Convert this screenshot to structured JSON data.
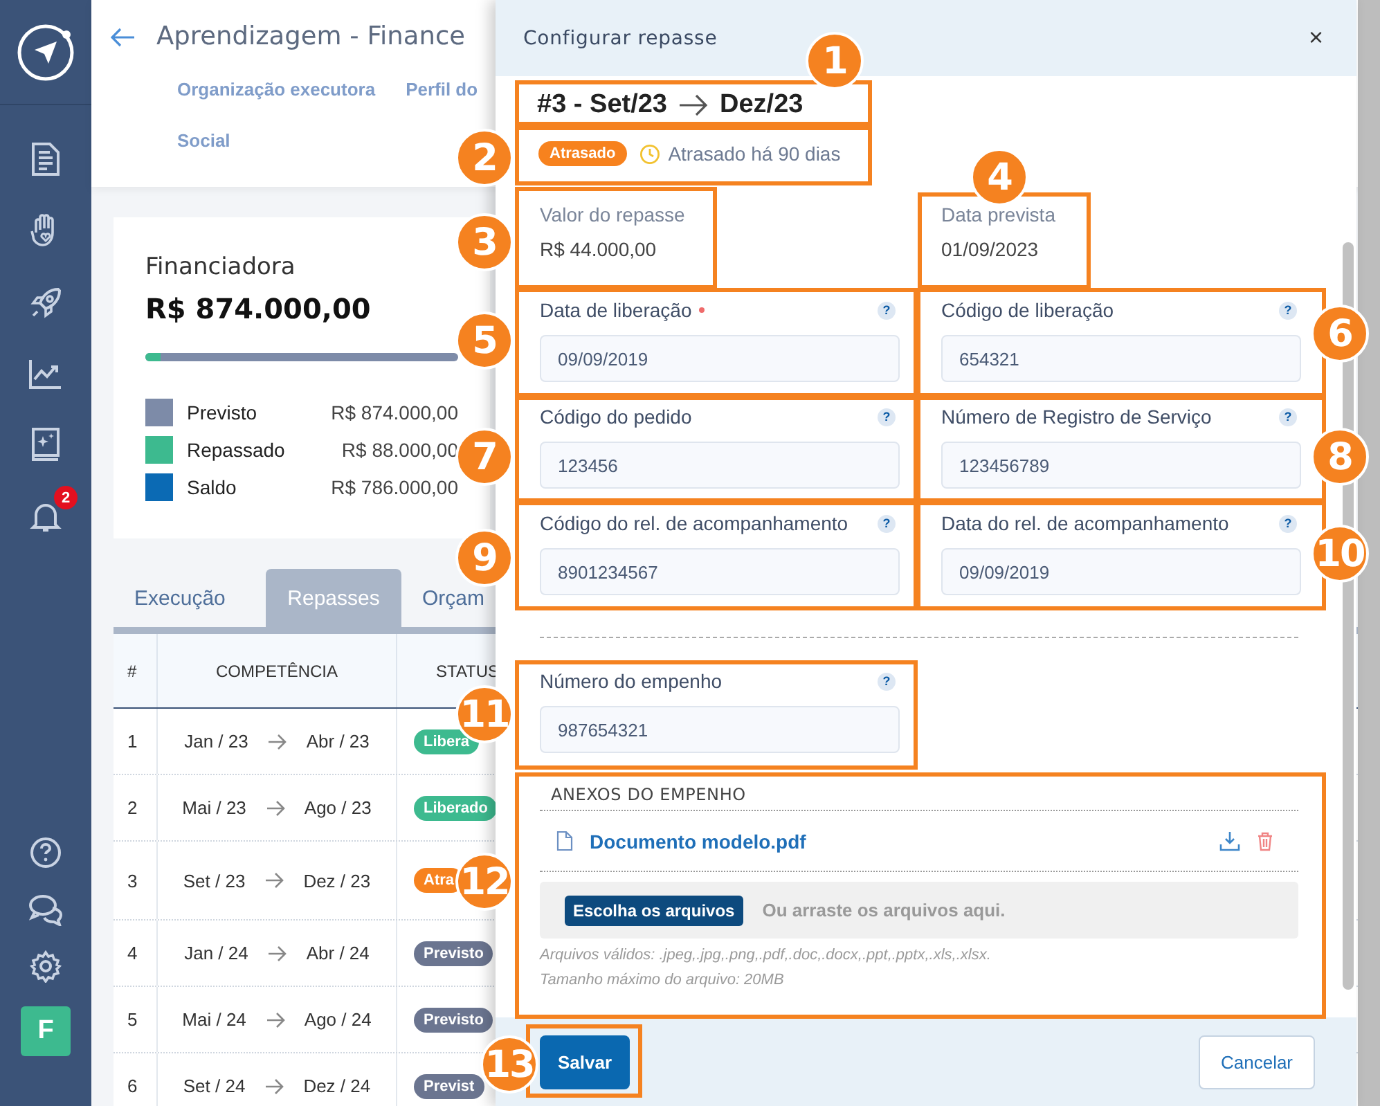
{
  "sidebar": {
    "notification_count": "2",
    "avatar": "F"
  },
  "page": {
    "title": "Aprendizagem - Finance",
    "nav_links": [
      "Organização executora",
      "Perfil do",
      "Social"
    ],
    "summary": {
      "title": "Financiadora",
      "total": "R$ 874.000,00",
      "progress": {
        "level": 0.05
      },
      "legend": [
        {
          "label": "Previsto",
          "value": "R$ 874.000,00",
          "color": "#7d8ba8"
        },
        {
          "label": "Repassado",
          "value": "R$ 88.000,00",
          "color": "#3dba8f"
        },
        {
          "label": "Saldo",
          "value": "R$ 786.000,00",
          "color": "#0b6ab4"
        }
      ]
    },
    "tabs": [
      {
        "label": "Execução",
        "selected": false
      },
      {
        "label": "Repasses",
        "selected": true
      },
      {
        "label": "Orçam",
        "selected": false
      }
    ],
    "table": {
      "columns": [
        "#",
        "COMPETÊNCIA",
        "STATUS"
      ],
      "rows": [
        {
          "number": "1",
          "from": "Jan / 23",
          "to": "Abr / 23",
          "status": "Libera",
          "kind": "released"
        },
        {
          "number": "2",
          "from": "Mai / 23",
          "to": "Ago / 23",
          "status": "Liberado",
          "kind": "released"
        },
        {
          "number": "3",
          "from": "Set / 23",
          "to": "Dez / 23",
          "status": "Atra",
          "kind": "late"
        },
        {
          "number": "4",
          "from": "Jan / 24",
          "to": "Abr / 24",
          "status": "Previsto",
          "kind": "planned"
        },
        {
          "number": "5",
          "from": "Mai / 24",
          "to": "Ago / 24",
          "status": "Previsto",
          "kind": "planned"
        },
        {
          "number": "6",
          "from": "Set / 24",
          "to": "Dez / 24",
          "status": "Previst",
          "kind": "planned"
        }
      ]
    }
  },
  "modal": {
    "title": "Configurar repasse",
    "close": "×",
    "period_from": "#3 - Set/23",
    "period_to": "Dez/23",
    "status": {
      "label": "Atrasado",
      "kind": "late"
    },
    "delay": "Atrasado há 90 dias",
    "info": [
      {
        "label": "Valor do repasse",
        "value": "R$ 44.000,00"
      },
      {
        "label": "Data prevista",
        "value": "01/09/2023"
      }
    ],
    "fields": [
      {
        "label": "Data de liberação",
        "value": "09/09/2019",
        "required": true,
        "help": "?"
      },
      {
        "label": "Código de liberação",
        "value": "654321",
        "required": false,
        "help": "?"
      },
      {
        "label": "Código do pedido",
        "value": "123456",
        "required": false,
        "help": "?"
      },
      {
        "label": "Número de Registro de Serviço",
        "value": "123456789",
        "required": false,
        "help": "?"
      },
      {
        "label": "Código do rel. de acompanhamento",
        "value": "8901234567",
        "required": false,
        "help": "?"
      },
      {
        "label": "Data do rel. de acompanhamento",
        "value": "09/09/2019",
        "required": false,
        "help": "?"
      }
    ],
    "commitment": {
      "label": "Número do empenho",
      "value": "987654321",
      "required": false,
      "help": "?"
    },
    "attachments": {
      "title": "ANEXOS DO EMPENHO",
      "files": [
        {
          "name": "Documento modelo.pdf"
        }
      ],
      "choose_button": "Escolha os arquivos",
      "drop_hint": "Ou arraste os arquivos aqui.",
      "notes": [
        "Arquivos válidos: .jpeg,.jpg,.png,.pdf,.doc,.docx,.ppt,.pptx,.xls,.xlsx.",
        "Tamanho máximo do arquivo: 20MB"
      ]
    },
    "save": "Salvar",
    "cancel": "Cancelar"
  },
  "annotations": [
    "1",
    "2",
    "3",
    "4",
    "5",
    "6",
    "7",
    "8",
    "9",
    "10",
    "11",
    "12",
    "13"
  ]
}
